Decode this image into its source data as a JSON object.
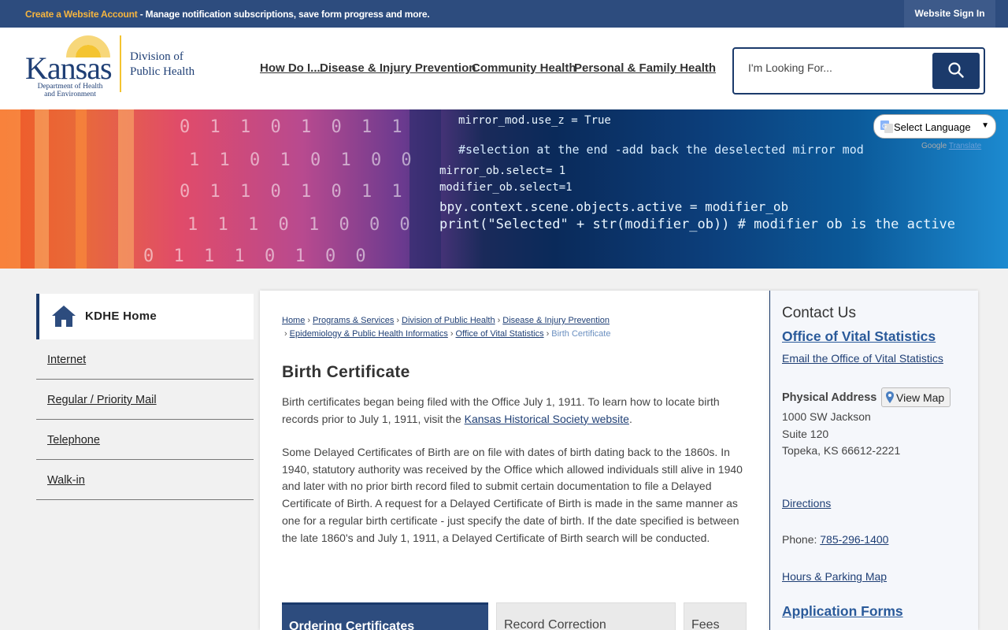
{
  "topbar": {
    "account_link": "Create a Website Account",
    "account_message": " - Manage notification subscriptions, save form progress and more.",
    "sign_in": "Website Sign In"
  },
  "logo": {
    "wordmark": "Kansas",
    "subline1": "Department of Health",
    "subline2": "and Environment",
    "division_line1": "Division of",
    "division_line2": "Public Health"
  },
  "nav": {
    "items": [
      "How Do I...",
      "Disease & Injury Prevention",
      "Community Health",
      "Personal & Family Health"
    ]
  },
  "search": {
    "placeholder": "I'm Looking For..."
  },
  "banner": {
    "code_lines": [
      "mirror_mod.use_z = True",
      "#selection at the end -add back the deselected mirror mod",
      "mirror_ob.select= 1",
      "modifier_ob.select=1",
      "bpy.context.scene.objects.active = modifier_ob",
      "print(\"Selected\" + str(modifier_ob)) # modifier ob is the active"
    ],
    "digit_rows": [
      "0 1 1 0 1 0 1 1",
      "1 1 0 1 0 1 0 0",
      "0 1 1 0 1 0 1 1",
      "1 1 1 0 1 0 0 0",
      "0 1 1 1 0 1 0 0"
    ]
  },
  "translate": {
    "select_label": "Select Language",
    "powered": "Google",
    "translate_link": "Translate"
  },
  "sidebar": {
    "home_label": "KDHE Home",
    "items": [
      "Internet",
      "Regular / Priority Mail",
      "Telephone",
      "Walk-in"
    ]
  },
  "breadcrumb": {
    "items": [
      "Home",
      "Programs & Services",
      "Division of Public Health",
      "Disease & Injury Prevention",
      "Epidemiology & Public Health Informatics",
      "Office of Vital Statistics"
    ],
    "current": "Birth Certificate"
  },
  "content": {
    "title": "Birth Certificate",
    "para1_before": "Birth certificates began being filed with the Office July 1, 1911. To learn how to locate birth records prior to July 1, 1911, visit the ",
    "para1_link": "Kansas Historical Society website",
    "para1_after": ".",
    "para2": "Some Delayed Certificates of Birth are on file with dates of birth dating back to the 1860s. In 1940, statutory authority was received by the Office which allowed individuals still alive in 1940 and later with no prior birth record filed to submit certain documentation to file a Delayed Certificate of Birth. A request for a Delayed Certificate of Birth is made in the same manner as one for a regular birth certificate - just specify the date of birth. If the date specified is between the late 1860's and July 1, 1911, a Delayed Certificate of Birth search will be conducted."
  },
  "tabs": {
    "items": [
      "Ordering Certificates",
      "Record Correction",
      "Fees"
    ]
  },
  "contact": {
    "heading": "Contact Us",
    "office": "Office of Vital Statistics",
    "email": "Email the Office of Vital Statistics",
    "address_label": "Physical Address",
    "view_map": "View Map",
    "address_line1": "1000 SW Jackson",
    "address_line2": "Suite 120",
    "address_line3": "Topeka, KS 66612-2221",
    "directions": "Directions",
    "phone_label": "Phone: ",
    "phone_number": "785-296-1400",
    "hours": "Hours & Parking Map",
    "forms": "Application Forms"
  },
  "colors": {
    "topbar": "#2d4c7e",
    "accent_gold": "#f6b53f",
    "navy": "#1b3a6b",
    "link": "#1f3f75"
  }
}
